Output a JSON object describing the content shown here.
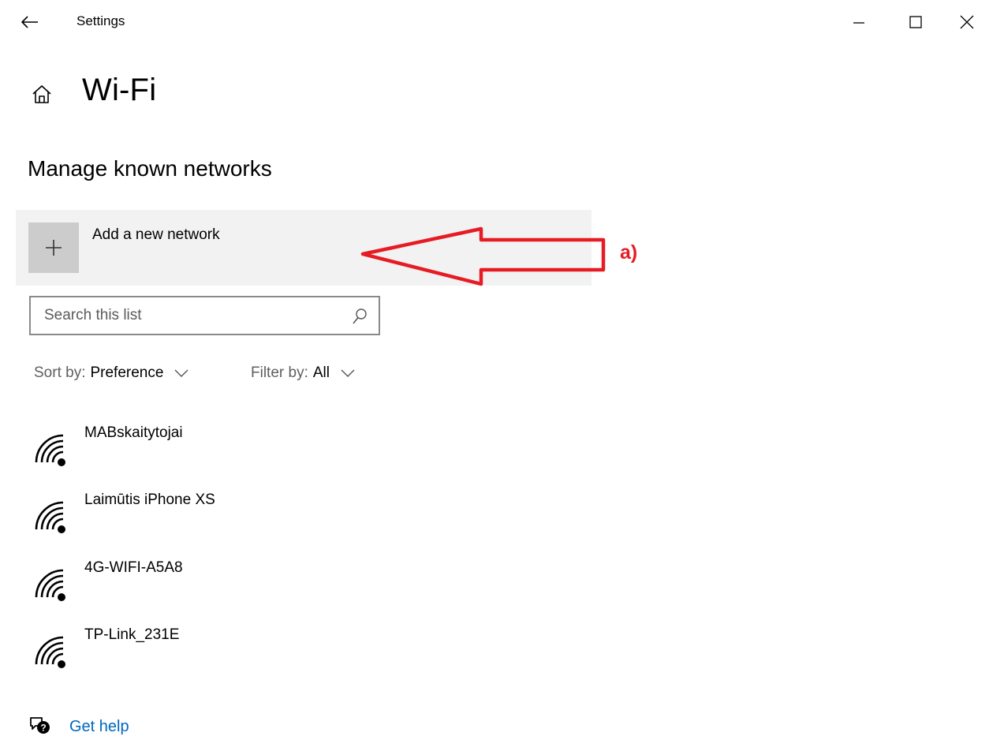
{
  "window": {
    "title": "Settings",
    "back_icon": "back-arrow-icon",
    "minimize_icon": "minimize-icon",
    "maximize_icon": "maximize-icon",
    "close_icon": "close-icon"
  },
  "header": {
    "home_icon": "home-icon",
    "title": "Wi-Fi"
  },
  "section": {
    "title": "Manage known networks"
  },
  "add_network": {
    "label": "Add a new network",
    "icon": "plus-icon"
  },
  "search": {
    "placeholder": "Search this list",
    "value": "",
    "icon": "search-icon"
  },
  "sort": {
    "label": "Sort by:",
    "value": "Preference"
  },
  "filter": {
    "label": "Filter by:",
    "value": "All"
  },
  "networks": [
    {
      "name": "MABskaitytojai",
      "icon": "wifi-secured-icon"
    },
    {
      "name": "Laimūtis iPhone XS",
      "icon": "wifi-secured-icon"
    },
    {
      "name": "4G-WIFI-A5A8",
      "icon": "wifi-secured-icon"
    },
    {
      "name": "TP-Link_231E",
      "icon": "wifi-secured-icon"
    }
  ],
  "help": {
    "label": "Get help",
    "icon": "help-chat-icon"
  },
  "annotation": {
    "label": "a)",
    "color": "#e61b23"
  },
  "colors": {
    "accent_link": "#0067c0",
    "row_background": "#f2f2f2",
    "tile_background": "#cccccc"
  }
}
